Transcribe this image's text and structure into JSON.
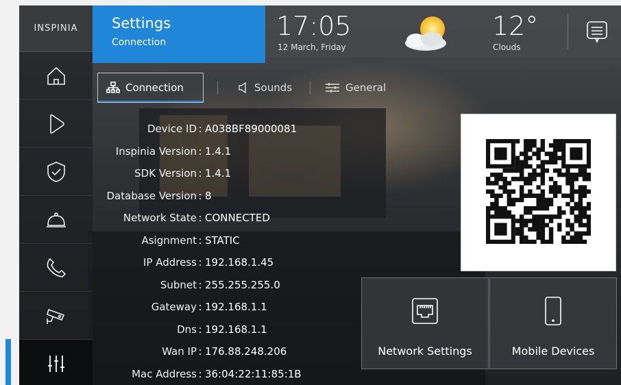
{
  "brand": {
    "logo_text": "INSPINIA"
  },
  "header": {
    "title": "Settings",
    "subtitle": "Connection",
    "time": "17:05",
    "date": "12 March, Friday",
    "temperature": "12°",
    "condition": "Clouds"
  },
  "tabs": [
    {
      "label": "Connection",
      "active": true
    },
    {
      "label": "Sounds",
      "active": false
    },
    {
      "label": "General",
      "active": false
    }
  ],
  "device_info": [
    {
      "label": "Device ID",
      "value": "A038BF89000081"
    },
    {
      "label": "Inspinia Version",
      "value": "1.4.1"
    },
    {
      "label": "SDK Version",
      "value": "1.4.1"
    },
    {
      "label": "Database Version",
      "value": "8"
    },
    {
      "label": "Network State",
      "value": "CONNECTED"
    },
    {
      "label": "Asignment",
      "value": "STATIC"
    },
    {
      "label": "IP Address",
      "value": "192.168.1.45"
    },
    {
      "label": "Subnet",
      "value": "255.255.255.0"
    },
    {
      "label": "Gateway",
      "value": "192.168.1.1"
    },
    {
      "label": "Dns",
      "value": "192.168.1.1"
    },
    {
      "label": "Wan IP",
      "value": "176.88.248.206"
    },
    {
      "label": "Mac Address",
      "value": "36:04:22:11:85:1B"
    }
  ],
  "actions": {
    "network_settings": "Network Settings",
    "mobile_devices": "Mobile Devices"
  },
  "colors": {
    "accent": "#1f86d8"
  },
  "sidebar_icons": [
    "home-icon",
    "play-icon",
    "shield-check-icon",
    "service-bell-icon",
    "phone-icon",
    "security-camera-icon",
    "sliders-icon"
  ]
}
